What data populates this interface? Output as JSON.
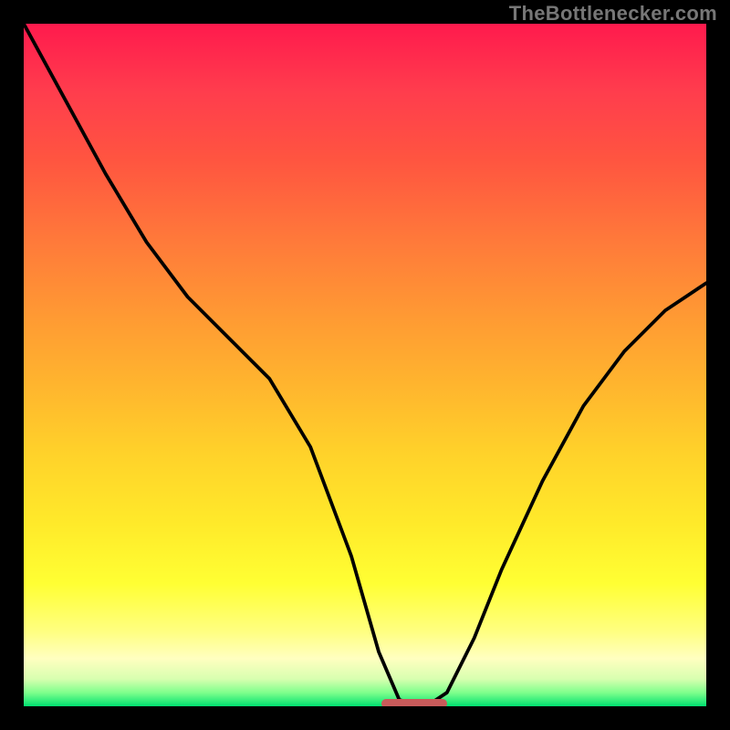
{
  "chart_data": {
    "type": "line",
    "title": "",
    "xlabel": "",
    "ylabel": "",
    "xlim": [
      0,
      100
    ],
    "ylim": [
      0,
      100
    ],
    "grid": false,
    "legend": false,
    "background": "rainbow-vertical-gradient",
    "series": [
      {
        "name": "curve",
        "x": [
          0,
          6,
          12,
          18,
          24,
          30,
          36,
          42,
          48,
          52,
          55,
          57,
          59,
          62,
          66,
          70,
          76,
          82,
          88,
          94,
          100
        ],
        "y": [
          100,
          89,
          78,
          68,
          60,
          54,
          48,
          38,
          22,
          8,
          1,
          0,
          0,
          2,
          10,
          20,
          33,
          44,
          52,
          58,
          62
        ]
      }
    ],
    "marker_band": {
      "x_start": 52,
      "x_end": 62,
      "y": 0,
      "color": "#c85a5a"
    }
  },
  "watermark": "TheBottlenecker.com"
}
